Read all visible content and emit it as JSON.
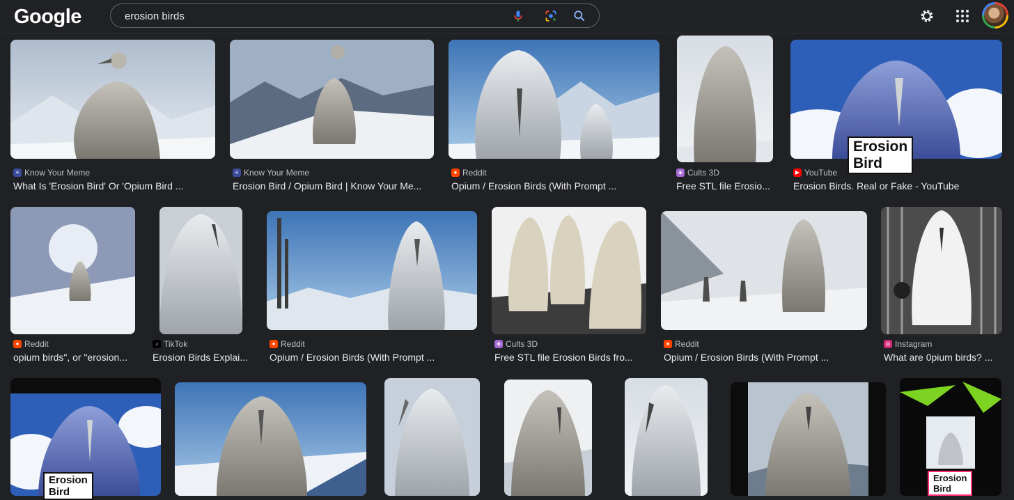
{
  "header": {
    "logo_text": "Google",
    "search_value": "erosion birds",
    "icons": [
      "mic-icon",
      "lens-icon",
      "search-icon",
      "gear-icon",
      "apps-icon",
      "avatar"
    ]
  },
  "colors": {
    "background": "#202124",
    "text": "#e8eaed",
    "source_text": "#bdc1c6",
    "reddit": "#ff4500",
    "youtube": "#ff0000",
    "kym": "#3b4b9c",
    "cults": "#a46ad6",
    "instagram": "#d62976"
  },
  "results": [
    {
      "source": "Know Your Meme",
      "favicon": "kym",
      "title": "What Is 'Erosion Bird' Or 'Opium Bird ..."
    },
    {
      "source": "Know Your Meme",
      "favicon": "kym",
      "title": "Erosion Bird / Opium Bird | Know Your Me..."
    },
    {
      "source": "Reddit",
      "favicon": "reddit",
      "title": "Opium / Erosion Birds (With Prompt ..."
    },
    {
      "source": "Cults 3D",
      "favicon": "cults",
      "title": "Free STL file Erosio..."
    },
    {
      "source": "YouTube",
      "favicon": "youtube",
      "title": "Erosion Birds. Real or Fake - YouTube",
      "overlay": "Erosion Bird"
    },
    {
      "source": "Reddit",
      "favicon": "reddit",
      "title": "opium birds\", or \"erosion..."
    },
    {
      "source": "TikTok",
      "favicon": "tiktok",
      "title": "Erosion Birds Explai..."
    },
    {
      "source": "Reddit",
      "favicon": "reddit",
      "title": "Opium / Erosion Birds (With Prompt ..."
    },
    {
      "source": "Cults 3D",
      "favicon": "cults",
      "title": "Free STL file Erosion Birds fro..."
    },
    {
      "source": "Reddit",
      "favicon": "reddit",
      "title": "Opium / Erosion Birds (With Prompt ..."
    },
    {
      "source": "Instagram",
      "favicon": "instagram",
      "title": "What are 0pium birds? ..."
    },
    {
      "overlay": "Erosion Bird"
    },
    {},
    {},
    {},
    {},
    {},
    {
      "overlay": "Erosion Bird"
    }
  ]
}
